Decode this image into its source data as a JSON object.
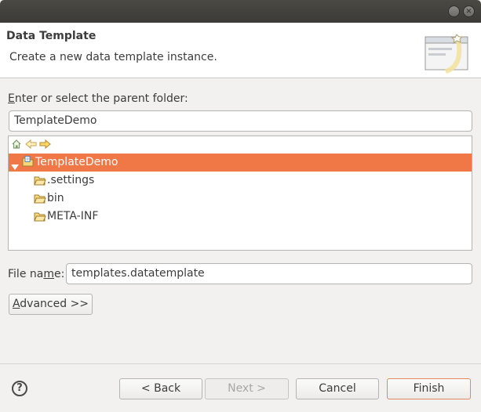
{
  "window": {
    "close_glyph": "×"
  },
  "header": {
    "title": "Data Template",
    "description": "Create a new data template instance."
  },
  "folder": {
    "label_pre": "",
    "label_mnemonic": "E",
    "label_post": "nter or select the parent folder:",
    "value": "TemplateDemo"
  },
  "tree": {
    "toolbar_icons": [
      "home-icon",
      "back-arrow-icon",
      "forward-arrow-icon"
    ],
    "root": {
      "label": "TemplateDemo",
      "expanded": true,
      "selected": true,
      "icon": "project-folder-icon"
    },
    "children": [
      {
        "label": ".settings",
        "icon": "folder-icon"
      },
      {
        "label": "bin",
        "icon": "folder-icon"
      },
      {
        "label": "META-INF",
        "icon": "folder-icon"
      }
    ]
  },
  "file_name": {
    "label_pre": "File na",
    "label_mnemonic": "m",
    "label_post": "e:",
    "value": "templates.datatemplate"
  },
  "advanced": {
    "label_mnemonic": "A",
    "label_post": "dvanced >>"
  },
  "footer": {
    "help_glyph": "?",
    "back_label": "< Back",
    "next_label": "Next >",
    "cancel_label": "Cancel",
    "finish_label": "Finish"
  },
  "colors": {
    "selection": "#f07746",
    "titlebar": "#3c3b37",
    "window_bg": "#f2f1f0"
  }
}
